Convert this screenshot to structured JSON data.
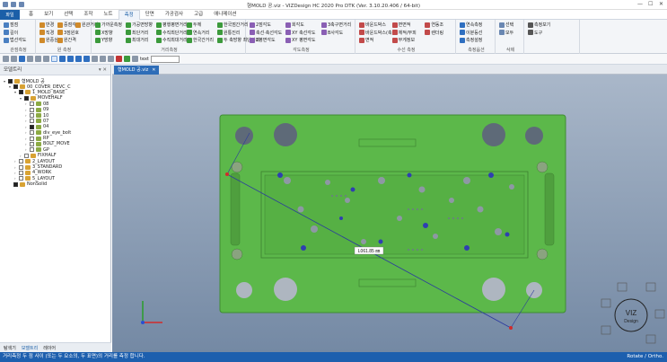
{
  "window": {
    "title": "형MOLD 공.viz - VIZDesign HC 2020 Pro DTK (Ver. 3.10.20.406 / 64-bit)",
    "controls": [
      "—",
      "☐",
      "✕"
    ]
  },
  "menu": {
    "file": "파일",
    "tabs": [
      "홈",
      "보기",
      "선택",
      "조작",
      "노트",
      "측정",
      "단면",
      "가공검사",
      "고급",
      "애니메이션"
    ],
    "active_tab": "측정"
  },
  "ribbon": {
    "groups": [
      {
        "label": "관점측정",
        "items": [
          "점점",
          "길이",
          "법선각도"
        ]
      },
      {
        "label": "원 측정",
        "items": [
          "반경",
          "직경",
          "원중심",
          "중점각",
          "3점원호",
          "원간격",
          "원관거리"
        ]
      },
      {
        "label": "거리측정",
        "items": [
          "가까운측정",
          "X방향",
          "Y방향",
          "가공면방향",
          "최단거리",
          "최대거리",
          "평행평면거리",
          "수직최단거리",
          "수직최대거리",
          "두께",
          "연속거리",
          "한국간거리",
          "한국점간거리",
          "원통진리",
          "두 축방향 최단거리"
        ]
      },
      {
        "label": "각도측정",
        "items": [
          "2점각도",
          "축선·축선각도",
          "2평면각도",
          "회각도",
          "XY 축선각도",
          "XY 평면각도",
          "3축구면거리",
          "B사각도"
        ]
      },
      {
        "label": "수선 측정",
        "items": [
          "바운드박스",
          "바운드박스(축)",
          "면적",
          "면면적",
          "체적/부피",
          "무게정보",
          "연동조",
          "렌더링"
        ]
      },
      {
        "label": "측정옵션",
        "items": [
          "연속측정",
          "이분등선",
          "측정설정"
        ]
      },
      {
        "label": "삭제",
        "items": [
          "선택",
          "모두"
        ]
      },
      {
        "label": "",
        "items": [
          "측정보기",
          "도구"
        ]
      }
    ]
  },
  "toolbar": {
    "icons": [
      "new-icon",
      "open-icon",
      "save-icon",
      "print-icon",
      "undo-icon",
      "redo-icon",
      "select-icon",
      "rotate-icon",
      "pan-icon",
      "zoom-icon",
      "fit-icon",
      "view-front-icon",
      "view-top-icon",
      "view-iso-icon",
      "measure-icon",
      "section-icon",
      "note-icon"
    ],
    "text_label": "text",
    "search_value": ""
  },
  "tree_panel": {
    "title": "모델트리",
    "pin": "▾ ✕",
    "nodes": [
      {
        "level": 0,
        "expand": "▾",
        "checked": true,
        "label": "형MOLD 공",
        "color": "#d8a233"
      },
      {
        "level": 1,
        "expand": "▾",
        "checked": true,
        "label": "00_COVER_DEVC_C",
        "color": "#d8a233"
      },
      {
        "level": 2,
        "expand": "▾",
        "checked": true,
        "label": "1_MOLD_BASE",
        "color": "#d8a233"
      },
      {
        "level": 3,
        "expand": "▾",
        "checked": true,
        "label": "MOVEHALF",
        "color": "#d8a233"
      },
      {
        "level": 4,
        "expand": "›",
        "checked": false,
        "label": "08",
        "color": "#8caa44"
      },
      {
        "level": 4,
        "expand": "›",
        "checked": false,
        "label": "09",
        "color": "#8caa44"
      },
      {
        "level": 4,
        "expand": "›",
        "checked": false,
        "label": "10",
        "color": "#8caa44"
      },
      {
        "level": 4,
        "expand": "›",
        "checked": false,
        "label": "07",
        "color": "#8caa44"
      },
      {
        "level": 4,
        "expand": "›",
        "checked": true,
        "label": "04",
        "color": "#8caa44"
      },
      {
        "level": 4,
        "expand": "›",
        "checked": false,
        "label": "div_eye_bolt",
        "color": "#8caa44"
      },
      {
        "level": 4,
        "expand": "›",
        "checked": false,
        "label": "RP",
        "color": "#8caa44"
      },
      {
        "level": 4,
        "expand": "›",
        "checked": false,
        "label": "BOLT_MOVE",
        "color": "#8caa44"
      },
      {
        "level": 4,
        "expand": "›",
        "checked": false,
        "label": "GP",
        "color": "#8caa44"
      },
      {
        "level": 3,
        "expand": "›",
        "checked": false,
        "label": "FIXHALF",
        "color": "#d8a233"
      },
      {
        "level": 2,
        "expand": "›",
        "checked": false,
        "label": "2_LAYOUT",
        "color": "#d8a233"
      },
      {
        "level": 2,
        "expand": "›",
        "checked": false,
        "label": "3_STANDARD",
        "color": "#d8a233"
      },
      {
        "level": 2,
        "expand": "›",
        "checked": false,
        "label": "4_WORK",
        "color": "#d8a233"
      },
      {
        "level": 2,
        "expand": "›",
        "checked": false,
        "label": "5_LAYOUT",
        "color": "#d8a233"
      },
      {
        "level": 1,
        "expand": "",
        "checked": true,
        "label": "NonSolid",
        "color": "#d8a233"
      }
    ],
    "bottom_tabs": [
      "탐색기",
      "모델트리",
      "레이어"
    ],
    "active_bottom_tab": "모델트리"
  },
  "document": {
    "tab_label": "형MOLD 공.viz",
    "tab_close": "✕"
  },
  "viewport": {
    "measure_label": "L061.85 ㎜",
    "logo_top": "VIZ",
    "logo_bottom": "Design",
    "plate_color": "#5cb84a",
    "background_top": "#a9b7c9",
    "background_bottom": "#7489a4"
  },
  "status": {
    "prompt": "거리측정  두 점 사이 (또는 두 요소의, 두 표면)의 거리를 측정 합니다.",
    "right": "Rotate / Ortho."
  }
}
